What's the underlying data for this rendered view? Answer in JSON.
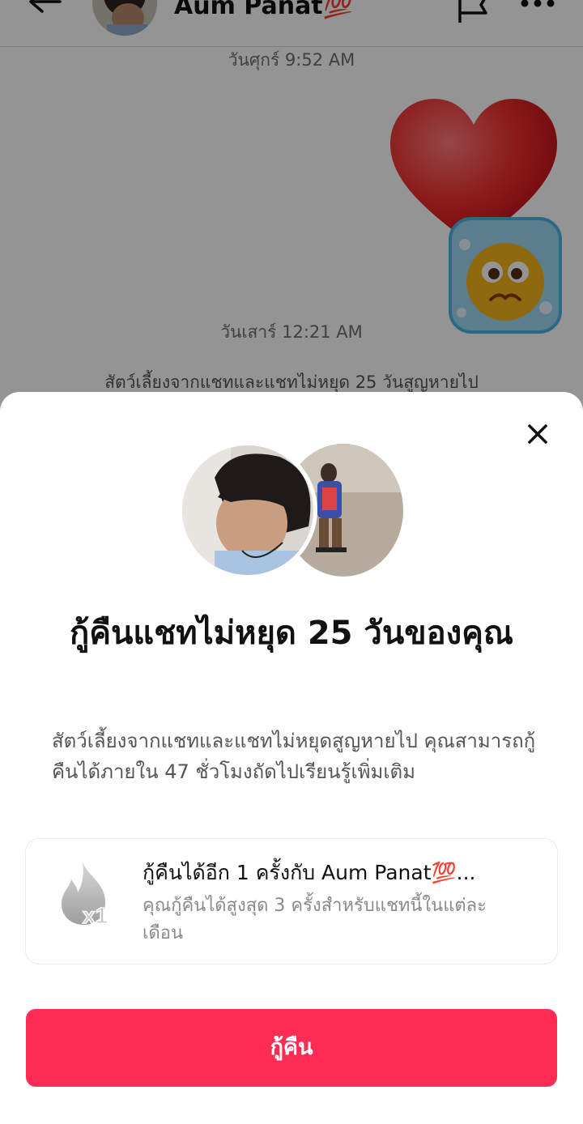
{
  "chat": {
    "contact_name": "Aum Panat💯",
    "timestamp_1": "วันศุกร์ 9:52 AM",
    "timestamp_2": "วันเสาร์ 12:21 AM",
    "system_message": "สัตว์เลี้ยงจากแชทและแชทไม่หยุด 25 วันสูญหายไป",
    "icons": {
      "back": "back-arrow-icon",
      "flag": "flag-icon",
      "more": "more-icon"
    }
  },
  "sheet": {
    "title": "กู้คืนแชทไม่หยุด 25 วันของคุณ",
    "description": "สัตว์เลี้ยงจากแชทและแชทไม่หยุดสูญหายไป คุณสามารถกู้คืนได้ภายใน 47 ชั่วโมงถัดไป",
    "learn_more": "เรียนรู้เพิ่มเติม",
    "card": {
      "badge": "x1",
      "title": "กู้คืนได้อีก 1 ครั้งกับ Aum Panat💯...",
      "subtitle": "คุณกู้คืนได้สูงสุด 3 ครั้งสำหรับแชทนี้ในแต่ละเดือน"
    },
    "restore_button": "กู้คืน"
  },
  "colors": {
    "accent": "#fe2c55",
    "overlay": "rgba(0,0,0,0.42)"
  }
}
